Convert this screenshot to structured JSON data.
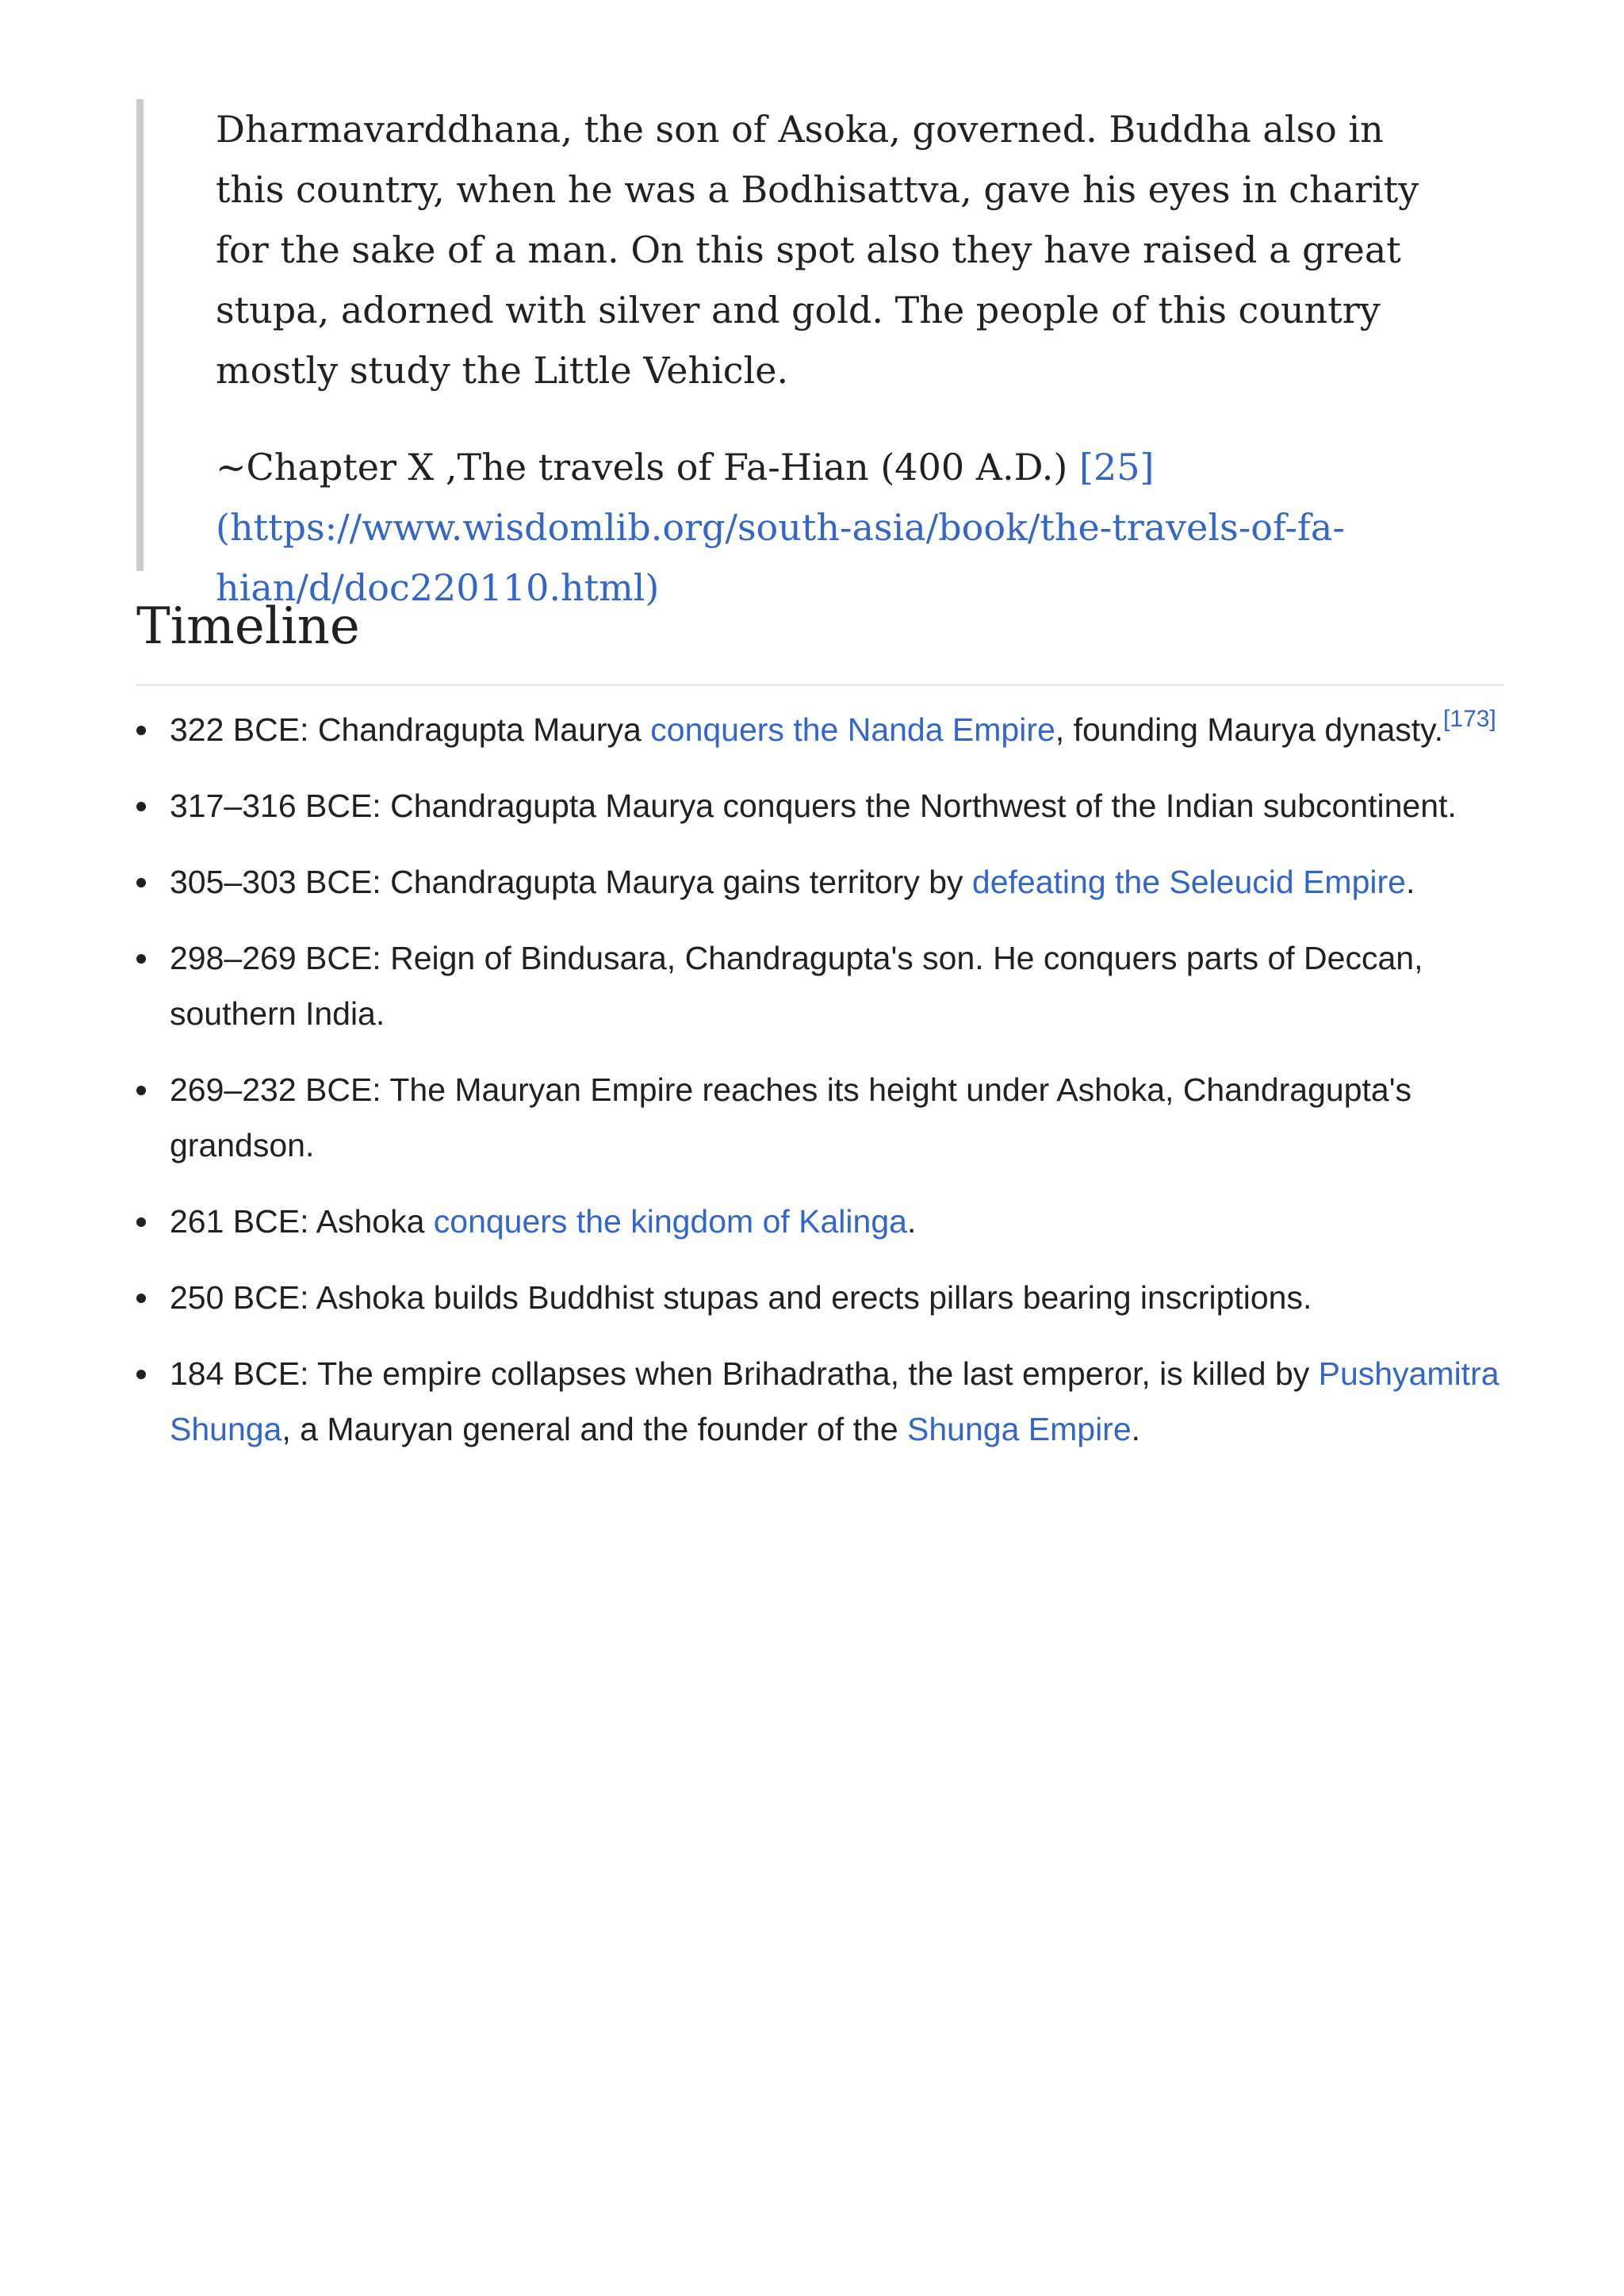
{
  "quote": {
    "text": "Dharmavarddhana, the son of Asoka, governed. Buddha also in this country, when he was a Bodhisattva, gave his eyes in charity for the sake of a man. On this spot also they have raised a great stupa, adorned with silver and gold. The people of this country mostly study the Little Vehicle.",
    "citation_text": "~Chapter X ,The travels of Fa-Hian (400 A.D.) ",
    "citation_link": "[25] (https://www.wisdomlib.org/south-asia/book/the-travels-of-fa-hian/d/doc220110.html)"
  },
  "section": {
    "title": "Timeline"
  },
  "timeline": [
    {
      "pre": "322 BCE: Chandragupta Maurya ",
      "link": "conquers the Nanda Empire",
      "post": ", founding Maurya dynasty.",
      "ref": "[173]"
    },
    {
      "pre": "317–316 BCE: Chandragupta Maurya conquers the Northwest of the Indian subcontinent."
    },
    {
      "pre": "305–303 BCE: Chandragupta Maurya gains territory by ",
      "link": "defeating the Seleucid Empire",
      "post": "."
    },
    {
      "pre": "298–269 BCE: Reign of Bindusara, Chandragupta's son. He conquers parts of Deccan, southern India."
    },
    {
      "pre": "269–232 BCE: The Mauryan Empire reaches its height under Ashoka, Chandragupta's grandson."
    },
    {
      "pre": "261 BCE: Ashoka ",
      "link": "conquers the kingdom of Kalinga",
      "post": "."
    },
    {
      "pre": "250 BCE: Ashoka builds Buddhist stupas and erects pillars bearing inscriptions."
    },
    {
      "pre": "184 BCE: The empire collapses when Brihadratha, the last emperor, is killed by ",
      "link": "Pushyamitra Shunga",
      "post": ", a Mauryan general and the founder of the ",
      "link2": "Shunga Empire",
      "post2": "."
    }
  ]
}
